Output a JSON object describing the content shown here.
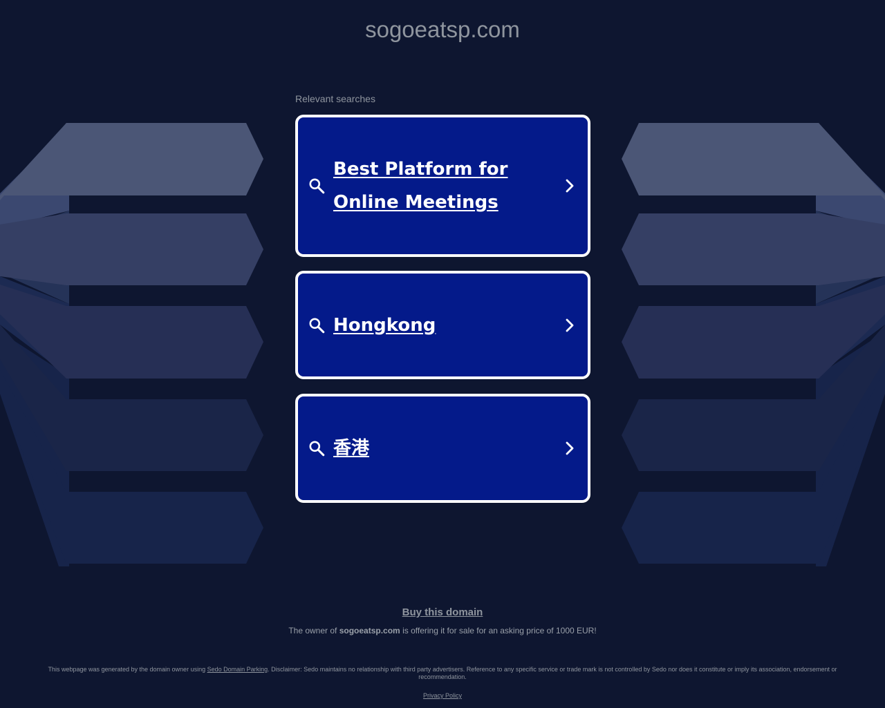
{
  "header": {
    "domain": "sogoeatsp.com"
  },
  "main": {
    "relevant_label": "Relevant searches",
    "searches": [
      {
        "label": "Best Platform for Online Meetings"
      },
      {
        "label": "Hongkong"
      },
      {
        "label": "香港"
      }
    ]
  },
  "footer": {
    "buy_label": "Buy this domain",
    "sale_prefix": "The owner of",
    "sale_domain": "sogoeatsp.com",
    "sale_suffix": "is offering it for sale for an asking price of 1000 EUR!",
    "disclaimer_prefix": "This webpage was generated by the domain owner using",
    "disclaimer_link": "Sedo Domain Parking",
    "disclaimer_suffix": ". Disclaimer: Sedo maintains no relationship with third party advertisers. Reference to any specific service or trade mark is not controlled by Sedo nor does it constitute or imply its association, endorsement or recommendation.",
    "privacy_label": "Privacy Policy"
  },
  "colors": {
    "background": "#0e1630",
    "card_fill": "#041a8a",
    "card_border": "#ffffff",
    "muted_text": "#8f959e"
  },
  "icons": {
    "search": "search-icon",
    "chevron": "chevron-right-icon"
  }
}
